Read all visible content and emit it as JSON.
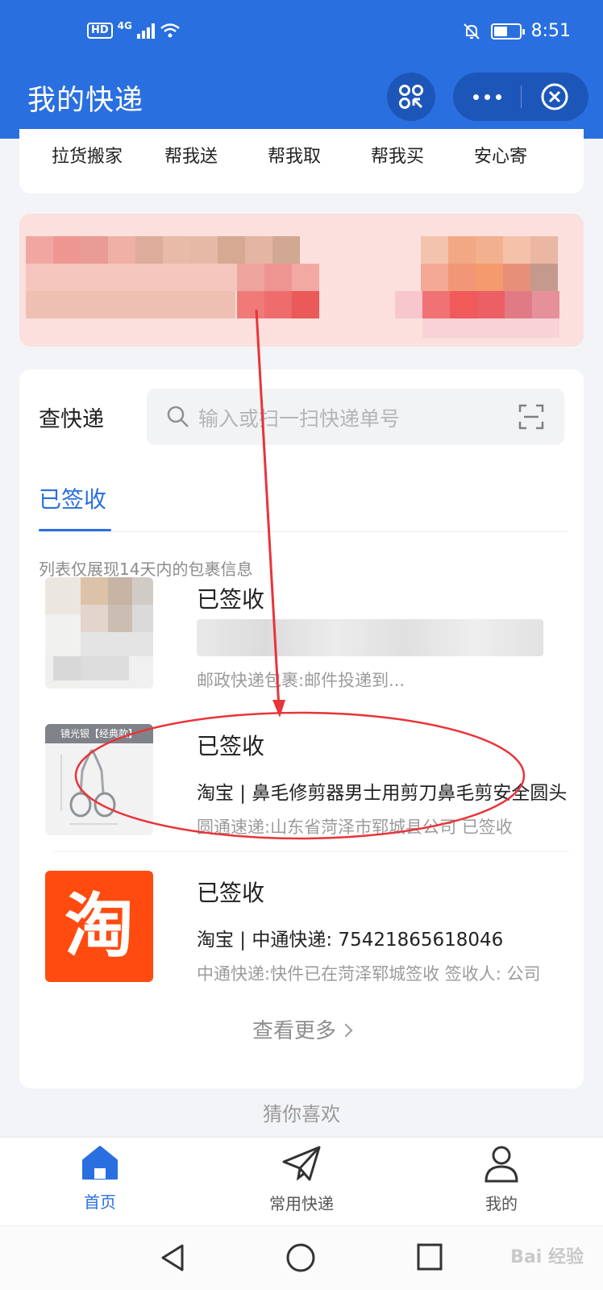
{
  "status_bar": {
    "hd": "HD",
    "network": "4G",
    "time": "8:51",
    "battery_level": 0.55
  },
  "header": {
    "title": "我的快递",
    "scan_icon": "scan-code-icon",
    "more_icon": "more-dots-icon",
    "close_icon": "close-circle-icon"
  },
  "services": [
    "拉货搬家",
    "帮我送",
    "帮我取",
    "帮我买",
    "安心寄"
  ],
  "tracking": {
    "label": "查快递",
    "search_placeholder": "输入或扫一扫快递单号",
    "tab_active": "已签收",
    "note": "列表仅展现14天内的包裹信息"
  },
  "packages": [
    {
      "status": "已签收",
      "line1": "",
      "line2": "邮政快递包裹:邮件投递到..."
    },
    {
      "status": "已签收",
      "line1": "淘宝 | 鼻毛修剪器男士用剪刀鼻毛剪安全圆头",
      "line2": "圆通速递:山东省菏泽市郓城县公司 已签收",
      "thumb_caption": "镜光银【经典款】"
    },
    {
      "status": "已签收",
      "line1": "淘宝 | 中通快递: 75421865618046",
      "line2": "中通快递:快件已在菏泽郓城签收 签收人: 公司",
      "logo_char": "淘"
    }
  ],
  "view_more": "查看更多",
  "guess_heading": "猜你喜欢",
  "tabbar": [
    {
      "label": "首页",
      "icon": "home-icon",
      "active": true
    },
    {
      "label": "常用快递",
      "icon": "paper-plane-icon",
      "active": false
    },
    {
      "label": "我的",
      "icon": "person-icon",
      "active": false
    }
  ],
  "watermark": "Bai 经验",
  "colors": {
    "primary": "#2a6fdf",
    "annotation_red": "#e8343a",
    "taobao_orange": "#ff4b0f"
  }
}
